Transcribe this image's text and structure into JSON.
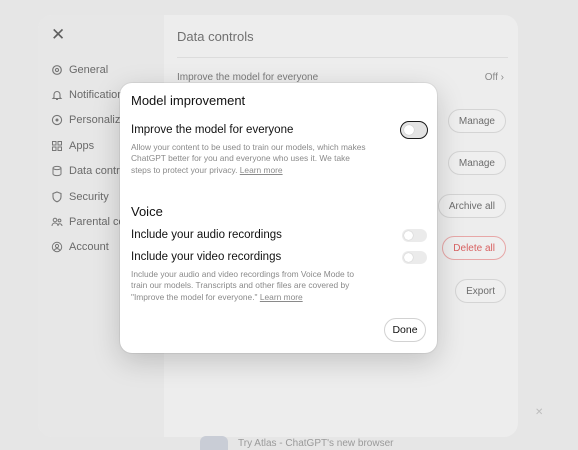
{
  "settings": {
    "close_icon": "close-icon",
    "title": "Data controls",
    "nav": [
      {
        "label": "General",
        "icon": "gear-icon"
      },
      {
        "label": "Notification",
        "icon": "bell-icon"
      },
      {
        "label": "Personaliza",
        "icon": "personalization-icon"
      },
      {
        "label": "Apps",
        "icon": "apps-grid-icon"
      },
      {
        "label": "Data contro",
        "icon": "database-icon"
      },
      {
        "label": "Security",
        "icon": "shield-icon"
      },
      {
        "label": "Parental co",
        "icon": "people-icon"
      },
      {
        "label": "Account",
        "icon": "person-circle-icon"
      }
    ],
    "rows": {
      "improve_label": "Improve the model for everyone",
      "improve_value": "Off",
      "manage_1": "Manage",
      "manage_2": "Manage",
      "archive_all": "Archive all",
      "delete_all": "Delete all",
      "export": "Export"
    },
    "banner": "Try Atlas - ChatGPT's new browser"
  },
  "modal": {
    "title": "Model improvement",
    "improve": {
      "label": "Improve the model for everyone",
      "description": "Allow your content to be used to train our models, which makes ChatGPT better for you and everyone who uses it. We take steps to protect your privacy.",
      "learn_more": "Learn more",
      "enabled": false
    },
    "voice_section": "Voice",
    "audio": {
      "label": "Include your audio recordings",
      "enabled": false
    },
    "video": {
      "label": "Include your video recordings",
      "enabled": false,
      "description": "Include your audio and video recordings from Voice Mode to train our models. Transcripts and other files are covered by \"Improve the model for everyone.\"",
      "learn_more": "Learn more"
    },
    "done": "Done"
  },
  "colors": {
    "danger": "#d86262",
    "dim_bg": "#e6e6e6"
  }
}
